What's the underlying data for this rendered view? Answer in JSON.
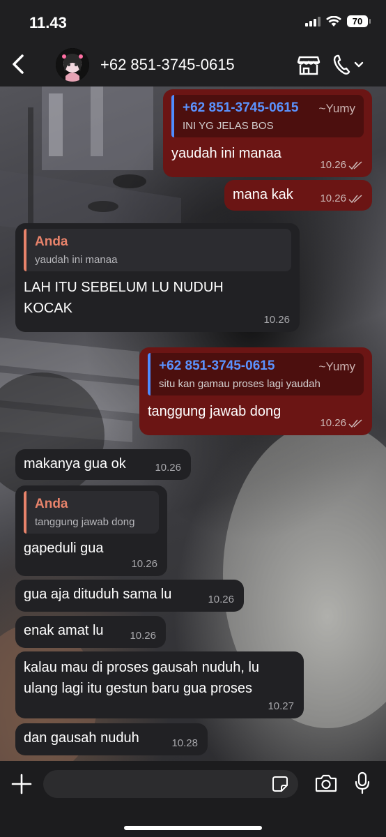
{
  "status_bar": {
    "time": "11.43",
    "battery": "70"
  },
  "header": {
    "contact": "+62 851-3745-0615"
  },
  "messages": [
    {
      "dir": "out",
      "quote": {
        "author": "+62 851-3745-0615",
        "alias": "~Yumy",
        "text": "INI YG JELAS BOS"
      },
      "text": "yaudah ini manaa",
      "time": "10.26"
    },
    {
      "dir": "out",
      "text": "mana kak",
      "time": "10.26"
    },
    {
      "dir": "in",
      "quote": {
        "author": "Anda",
        "text": "yaudah ini manaa"
      },
      "text": "LAH ITU SEBELUM LU NUDUH KOCAK",
      "time": "10.26"
    },
    {
      "dir": "out",
      "quote": {
        "author": "+62 851-3745-0615",
        "alias": "~Yumy",
        "text": "situ kan gamau proses lagi yaudah"
      },
      "text": "tanggung jawab dong",
      "time": "10.26"
    },
    {
      "dir": "in",
      "text": "makanya gua ok",
      "time": "10.26"
    },
    {
      "dir": "in",
      "quote": {
        "author": "Anda",
        "text": "tanggung jawab dong"
      },
      "text": "gapeduli gua",
      "time": "10.26"
    },
    {
      "dir": "in",
      "text": "gua aja dituduh sama lu",
      "time": "10.26"
    },
    {
      "dir": "in",
      "text": "enak amat lu",
      "time": "10.26"
    },
    {
      "dir": "in",
      "text": "kalau mau di  proses gausah nuduh, lu ulang lagi itu gestun baru gua proses",
      "time": "10.27"
    },
    {
      "dir": "in",
      "text": "dan gausah nuduh",
      "time": "10.28"
    }
  ],
  "composer": {
    "placeholder": ""
  }
}
